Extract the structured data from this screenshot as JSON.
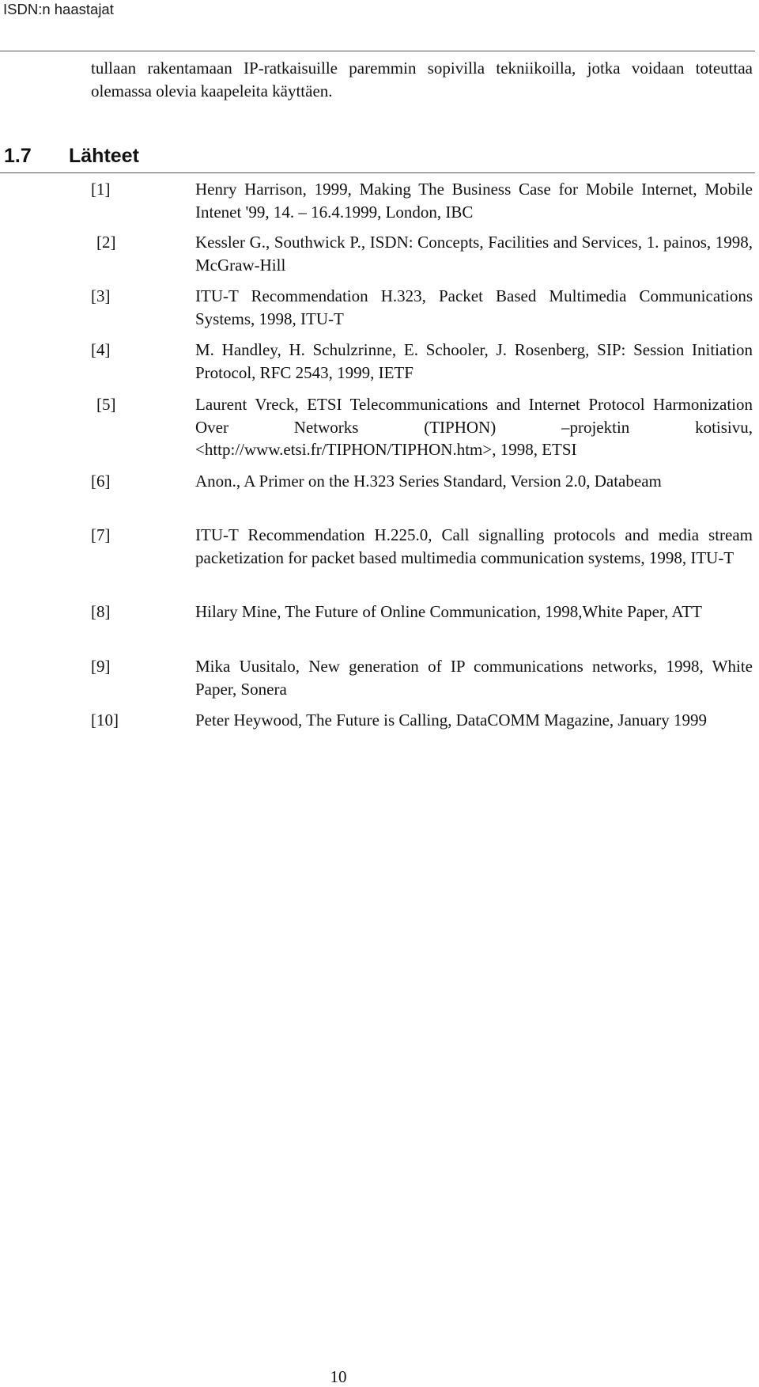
{
  "header": {
    "running_title": "ISDN:n haastajat"
  },
  "body": {
    "paragraph": "tullaan rakentamaan IP-ratkaisuille paremmin sopivilla tekniikoilla, jotka voidaan toteuttaa olemassa olevia kaapeleita käyttäen."
  },
  "section": {
    "number": "1.7",
    "title": "Lähteet"
  },
  "references": [
    {
      "label": "[1]",
      "text": "Henry Harrison, 1999, Making The Business Case for Mobile Internet, Mobile Intenet '99, 14. – 16.4.1999, London, IBC"
    },
    {
      "label": "[2]",
      "text": "Kessler G., Southwick P., ISDN: Concepts, Facilities and Services, 1. painos, 1998, McGraw-Hill"
    },
    {
      "label": "[3]",
      "text": "ITU-T Recommendation H.323, Packet Based Multimedia Communications Systems, 1998, ITU-T"
    },
    {
      "label": "[4]",
      "text": "M. Handley, H. Schulzrinne, E. Schooler, J. Rosenberg, SIP: Session Initiation Protocol, RFC 2543, 1999, IETF"
    },
    {
      "label": "[5]",
      "text": "Laurent Vreck, ETSI Telecommunications and Internet Protocol Harmonization Over Networks (TIPHON) –projektin kotisivu, <http://www.etsi.fr/TIPHON/TIPHON.htm>, 1998, ETSI"
    },
    {
      "label": "[6]",
      "text": "Anon., A Primer on the H.323 Series Standard, Version 2.0, Databeam"
    },
    {
      "label": "[7]",
      "text": "ITU-T Recommendation H.225.0, Call signalling protocols and media stream packetization for packet based multimedia communication systems, 1998, ITU-T"
    },
    {
      "label": "[8]",
      "text": "Hilary Mine, The Future of Online Communication, 1998,White Paper, ATT"
    },
    {
      "label": "[9]",
      "text": "Mika Uusitalo, New generation of IP communications networks, 1998, White Paper, Sonera"
    },
    {
      "label": "[10]",
      "text": "Peter Heywood, The Future is Calling, DataCOMM Magazine, January 1999"
    }
  ],
  "footer": {
    "page_number": "10"
  }
}
